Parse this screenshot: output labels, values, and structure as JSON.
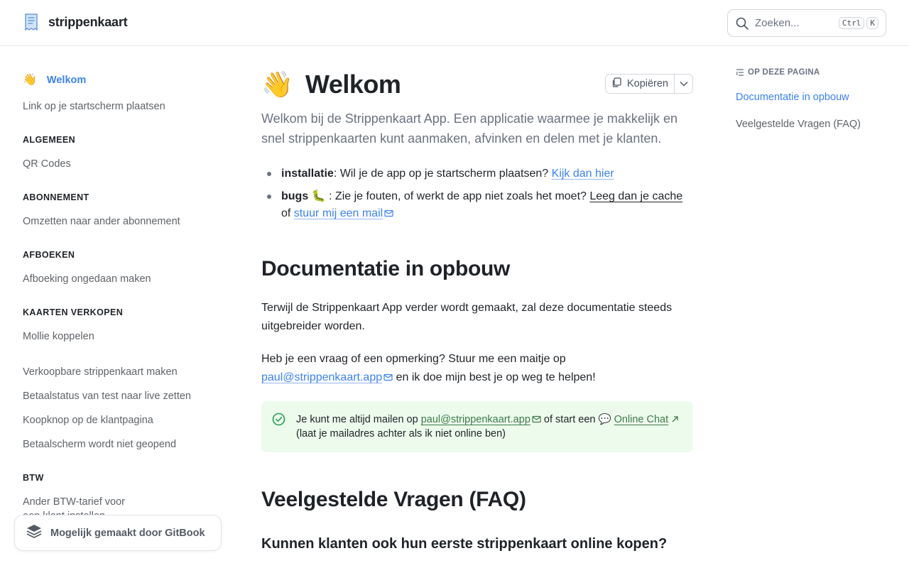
{
  "header": {
    "brand_name": "strippenkaart",
    "brand_icon": "receipt-icon",
    "search_placeholder": "Zoeken...",
    "shortcut_keys": [
      "Ctrl",
      "K"
    ]
  },
  "sidebar": {
    "active_item": {
      "emoji": "👋",
      "label": "Welkom"
    },
    "items": {
      "startscherm": "Link op je startscherm plaatsen",
      "qr": "QR Codes",
      "omzetten": "Omzetten naar ander abonnement",
      "afboeking": "Afboeking ongedaan maken",
      "mollie": "Mollie koppelen",
      "verkoopbaar": "Verkoopbare strippenkaart maken",
      "betaalstatus": "Betaalstatus van test naar live zetten",
      "koopknop": "Koopknop op de klantpagina",
      "betaalscherm": "Betaalscherm wordt niet geopend",
      "btw_tarief_line1": "Ander BTW-tarief voor",
      "btw_tarief_line2": "een klant instellen"
    },
    "sections": {
      "algemeen": "ALGEMEEN",
      "abonnement": "ABONNEMENT",
      "afboeken": "AFBOEKEN",
      "kaarten": "KAARTEN VERKOPEN",
      "btw": "BTW"
    },
    "gitbook_badge": "Mogelijk gemaakt door GitBook"
  },
  "main": {
    "title_emoji": "👋",
    "title": "Welkom",
    "copy_label": "Kopiëren",
    "lead": "Welkom bij de Strippenkaart App. Een applicatie waarmee je makkelijk en snel strippenkaarten kunt aanmaken, afvinken en delen met je klanten.",
    "bullet1": {
      "term": "installatie",
      "text": ": Wil je de app op je startscherm plaatsen? ",
      "link": "Kijk dan hier"
    },
    "bullet2": {
      "term": "bugs 🐛",
      "text": "  : Zie je fouten, of werkt de app niet zoals het moet? ",
      "link1": "Leeg dan je cache",
      "mid": " of ",
      "link2": "stuur mij een mail"
    },
    "section1": {
      "heading": "Documentatie in opbouw",
      "para1": "Terwijl de Strippenkaart App verder wordt gemaakt, zal deze documentatie steeds uitgebreider worden.",
      "para2_before": "Heb je een vraag of een opmerking? Stuur me een maitje op ",
      "para2_link": "paul@strippenkaart.app",
      "para2_after": " en ik doe mijn best je op weg te helpen!"
    },
    "hint": {
      "before": "Je kunt me altijd mailen op  ",
      "email": "paul@strippenkaart.app",
      "mid": " of start een 💬 ",
      "chat": "Online Chat",
      "after": " (laat je mailadres achter als ik niet online ben)"
    },
    "section2": {
      "heading": "Veelgestelde Vragen (FAQ)",
      "subheading": "Kunnen klanten ook hun eerste strippenkaart online kopen?"
    }
  },
  "toc": {
    "heading": "OP DEZE PAGINA",
    "items": [
      "Documentatie in opbouw",
      "Veelgestelde Vragen (FAQ)"
    ]
  },
  "colors": {
    "accent": "#3b82f6",
    "hint_bg": "#ecfbec",
    "hint_icon": "#22a052"
  }
}
